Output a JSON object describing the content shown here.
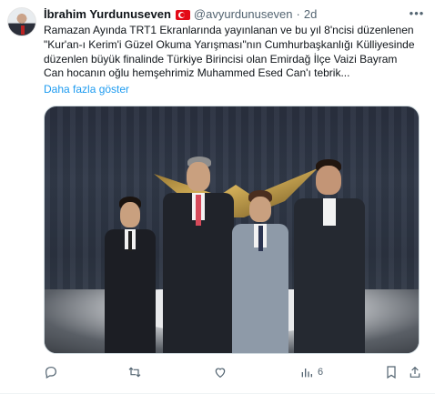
{
  "tweet": {
    "author_name": "İbrahim Yurdunuseven",
    "author_handle": "@avyurdunuseven",
    "separator": "·",
    "time": "2d",
    "more_icon": "more-dots-icon",
    "flag_icon": "turkey-flag-icon",
    "text_lines": [
      "Ramazan Ayında TRT1 Ekranlarında yayınlanan ve bu yıl 8'ncisi düzenlenen",
      "\"Kur'an-ı Kerim'i Güzel Okuma Yarışması\"nın Cumhurbaşkanlığı Külliyesinde",
      "düzenlen büyük finalinde Türkiye Birincisi olan Emirdağ İlçe Vaizi Bayram",
      "Can hocanın oğlu hemşehrimiz Muhammed Esed Can'ı tebrik..."
    ],
    "show_more": "Daha fazla göster",
    "actions": {
      "reply_icon": "reply-icon",
      "retweet_icon": "retweet-icon",
      "like_icon": "heart-icon",
      "views_icon": "views-chart-icon",
      "views_count": "6",
      "bookmark_icon": "bookmark-icon",
      "share_icon": "share-icon"
    },
    "colors": {
      "link": "#1d9bf0",
      "secondary_text": "#536471",
      "primary_text": "#0f1419",
      "flag_red": "#e30a17"
    }
  }
}
